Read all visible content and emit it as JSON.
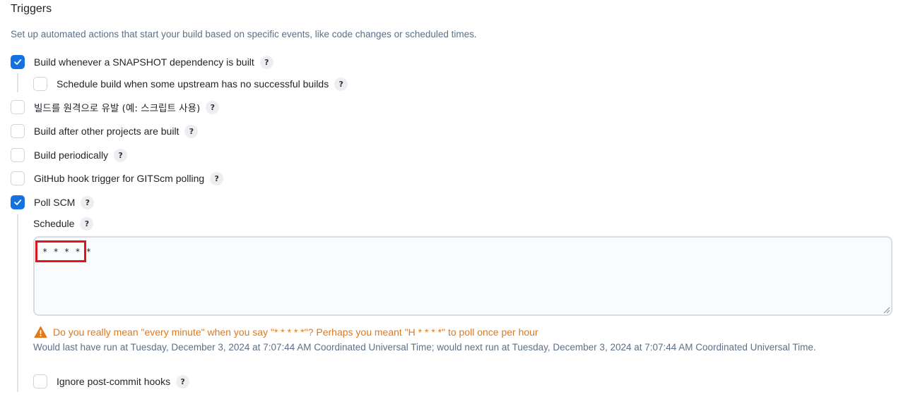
{
  "section": {
    "title": "Triggers",
    "description": "Set up automated actions that start your build based on specific events, like code changes or scheduled times."
  },
  "triggers": {
    "snapshot": {
      "label": "Build whenever a SNAPSHOT dependency is built",
      "checked": true
    },
    "upstream": {
      "label": "Schedule build when some upstream has no successful builds",
      "checked": false
    },
    "remote": {
      "label": "빌드를 원격으로 유발 (예: 스크립트 사용)",
      "checked": false
    },
    "after_other": {
      "label": "Build after other projects are built",
      "checked": false
    },
    "periodic": {
      "label": "Build periodically",
      "checked": false
    },
    "github_hook": {
      "label": "GitHub hook trigger for GITScm polling",
      "checked": false
    },
    "poll_scm": {
      "label": "Poll SCM",
      "checked": true
    }
  },
  "help_label": "?",
  "poll": {
    "schedule_label": "Schedule",
    "schedule_value": "* * * * *",
    "warning": "Do you really mean \"every minute\" when you say \"* * * * *\"? Perhaps you meant \"H * * * *\" to poll once per hour",
    "run_info": "Would last have run at Tuesday, December 3, 2024 at 7:07:44 AM Coordinated Universal Time; would next run at Tuesday, December 3, 2024 at 7:07:44 AM Coordinated Universal Time.",
    "ignore_hooks": {
      "label": "Ignore post-commit hooks",
      "checked": false
    }
  },
  "colors": {
    "accent": "#1472e0",
    "warning": "#e0791c",
    "highlight_box": "#e1141c",
    "muted_text": "#5b7189"
  },
  "icons": {
    "check": "check-icon",
    "help": "help-icon",
    "warning": "warning-icon",
    "resize": "resize-grip-icon"
  }
}
